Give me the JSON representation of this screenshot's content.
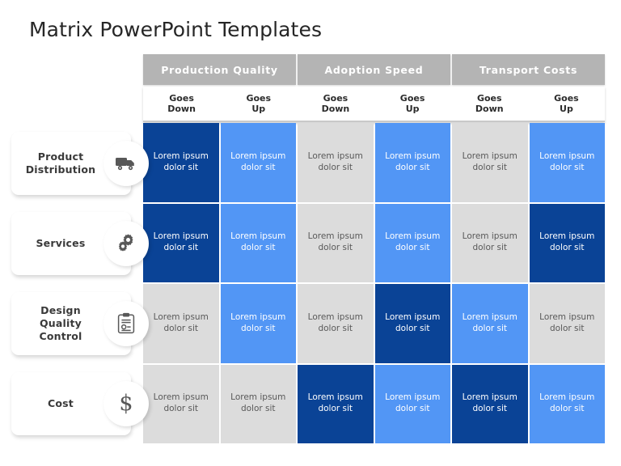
{
  "slide": {
    "title": "Matrix PowerPoint Templates"
  },
  "colors": {
    "dark_blue": "#0a4396",
    "mid_blue": "#5296f5",
    "gray": "#dcdcdc",
    "header_gray": "#b4b4b4",
    "title_text": "#262626"
  },
  "matrix": {
    "column_groups": [
      {
        "label": "Production  Quality"
      },
      {
        "label": "Adoption  Speed"
      },
      {
        "label": "Transport Costs"
      }
    ],
    "sub_headers": [
      {
        "line1": "Goes",
        "line2": "Down"
      },
      {
        "line1": "Goes",
        "line2": "Up"
      },
      {
        "line1": "Goes",
        "line2": "Down"
      },
      {
        "line1": "Goes",
        "line2": "Up"
      },
      {
        "line1": "Goes",
        "line2": "Down"
      },
      {
        "line1": "Goes",
        "line2": "Up"
      }
    ],
    "rows": [
      {
        "label_line1": "Product",
        "label_line2": "Distribution",
        "icon": "truck-icon",
        "cells": [
          {
            "text": "Lorem ipsum dolor sit",
            "level": "dark"
          },
          {
            "text": "Lorem ipsum dolor sit",
            "level": "mid"
          },
          {
            "text": "Lorem ipsum dolor sit",
            "level": "gray"
          },
          {
            "text": "Lorem ipsum dolor sit",
            "level": "mid"
          },
          {
            "text": "Lorem ipsum dolor sit",
            "level": "gray"
          },
          {
            "text": "Lorem ipsum dolor sit",
            "level": "mid"
          }
        ]
      },
      {
        "label_line1": "Services",
        "label_line2": "",
        "icon": "gears-icon",
        "cells": [
          {
            "text": "Lorem ipsum dolor sit",
            "level": "dark"
          },
          {
            "text": "Lorem ipsum dolor sit",
            "level": "mid"
          },
          {
            "text": "Lorem ipsum dolor sit",
            "level": "gray"
          },
          {
            "text": "Lorem ipsum dolor sit",
            "level": "mid"
          },
          {
            "text": "Lorem ipsum dolor sit",
            "level": "gray"
          },
          {
            "text": "Lorem ipsum dolor sit",
            "level": "dark"
          }
        ]
      },
      {
        "label_line1": "Design",
        "label_line2": "Quality",
        "label_line3": "Control",
        "icon": "clipboard-icon",
        "cells": [
          {
            "text": "Lorem ipsum dolor sit",
            "level": "gray"
          },
          {
            "text": "Lorem ipsum dolor sit",
            "level": "mid"
          },
          {
            "text": "Lorem ipsum dolor sit",
            "level": "gray"
          },
          {
            "text": "Lorem ipsum dolor sit",
            "level": "dark"
          },
          {
            "text": "Lorem ipsum dolor sit",
            "level": "mid"
          },
          {
            "text": "Lorem ipsum dolor sit",
            "level": "gray"
          }
        ]
      },
      {
        "label_line1": "Cost",
        "label_line2": "",
        "icon": "dollar-icon",
        "cells": [
          {
            "text": "Lorem ipsum dolor sit",
            "level": "gray"
          },
          {
            "text": "Lorem ipsum dolor sit",
            "level": "gray"
          },
          {
            "text": "Lorem ipsum dolor sit",
            "level": "dark"
          },
          {
            "text": "Lorem ipsum dolor sit",
            "level": "mid"
          },
          {
            "text": "Lorem ipsum dolor sit",
            "level": "dark"
          },
          {
            "text": "Lorem ipsum dolor sit",
            "level": "mid"
          }
        ]
      }
    ]
  }
}
